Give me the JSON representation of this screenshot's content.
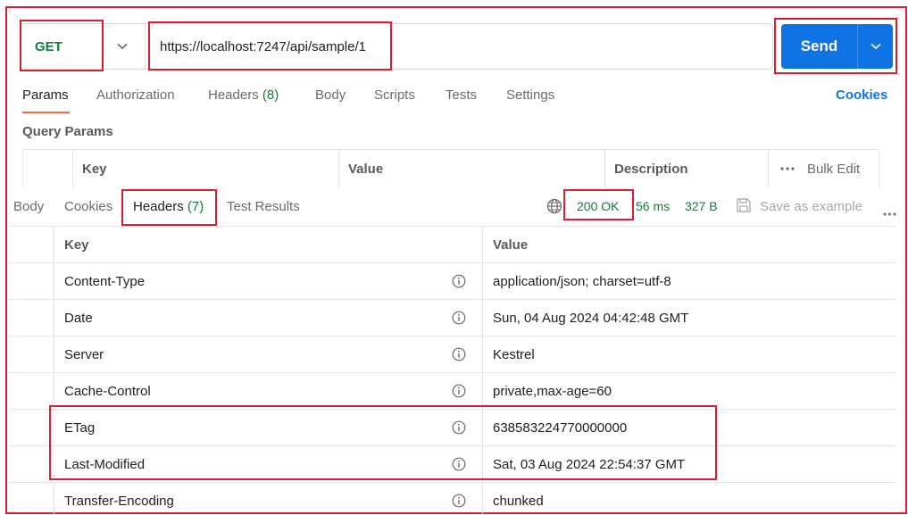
{
  "request": {
    "method": "GET",
    "url": "https://localhost:7247/api/sample/1",
    "send_label": "Send"
  },
  "request_tabs": {
    "params": "Params",
    "authorization": "Authorization",
    "headers": "Headers",
    "headers_count": "(8)",
    "body": "Body",
    "scripts": "Scripts",
    "tests": "Tests",
    "settings": "Settings",
    "cookies": "Cookies"
  },
  "query_params": {
    "title": "Query Params",
    "col_key": "Key",
    "col_value": "Value",
    "col_description": "Description",
    "bulk_edit": "Bulk Edit"
  },
  "response_tabs": {
    "body": "Body",
    "cookies": "Cookies",
    "headers": "Headers",
    "headers_count": "(7)",
    "test_results": "Test Results"
  },
  "response_meta": {
    "status": "200 OK",
    "time": "56 ms",
    "size": "327 B",
    "save_example": "Save as example"
  },
  "response_headers": {
    "col_key": "Key",
    "col_value": "Value",
    "rows": [
      {
        "key": "Content-Type",
        "value": "application/json; charset=utf-8"
      },
      {
        "key": "Date",
        "value": "Sun, 04 Aug 2024 04:42:48 GMT"
      },
      {
        "key": "Server",
        "value": "Kestrel"
      },
      {
        "key": "Cache-Control",
        "value": "private,max-age=60"
      },
      {
        "key": "ETag",
        "value": "638583224770000000"
      },
      {
        "key": "Last-Modified",
        "value": "Sat, 03 Aug 2024 22:54:37 GMT"
      },
      {
        "key": "Transfer-Encoding",
        "value": "chunked"
      }
    ]
  },
  "colors": {
    "accent_blue": "#0e74e6",
    "method_green": "#0b7f3b",
    "highlight_red": "#d3212f",
    "tab_underline": "#f26b3a"
  }
}
